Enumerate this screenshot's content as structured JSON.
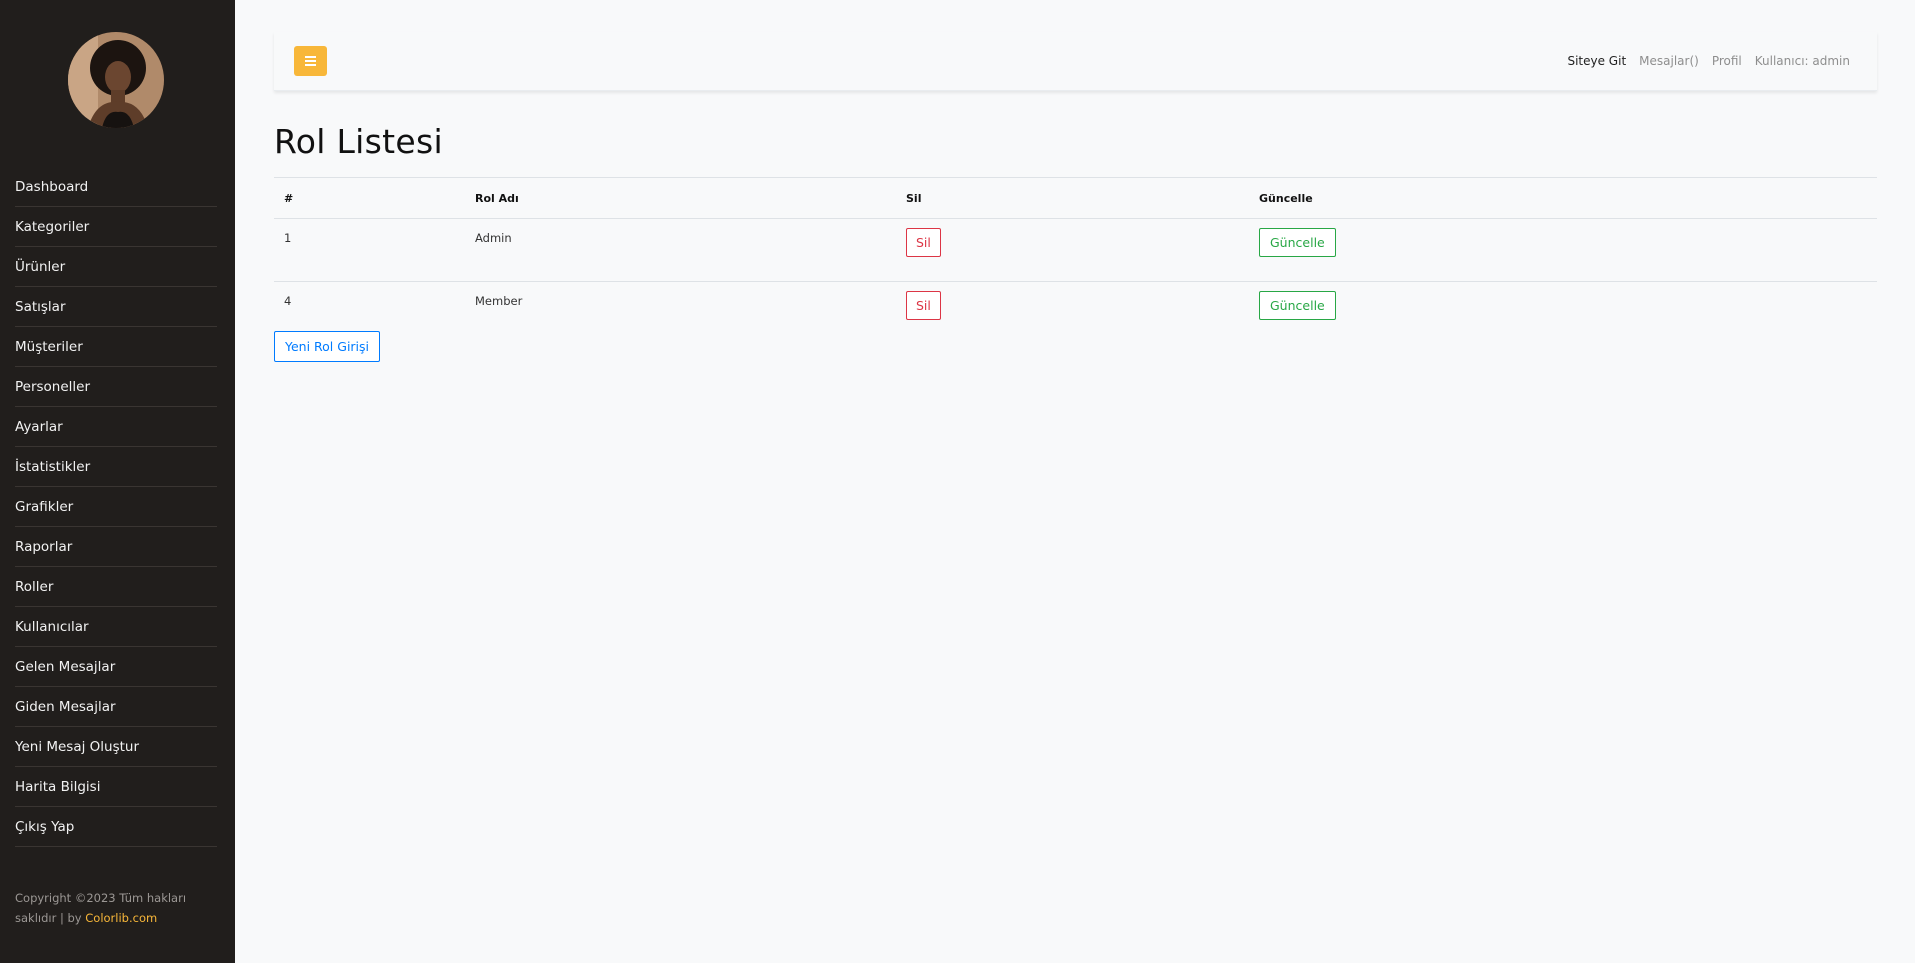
{
  "sidebar": {
    "avatar_alt": "profile-avatar",
    "items": [
      {
        "label": "Dashboard"
      },
      {
        "label": "Kategoriler"
      },
      {
        "label": "Ürünler"
      },
      {
        "label": "Satışlar"
      },
      {
        "label": "Müşteriler"
      },
      {
        "label": "Personeller"
      },
      {
        "label": "Ayarlar"
      },
      {
        "label": "İstatistikler"
      },
      {
        "label": "Grafikler"
      },
      {
        "label": "Raporlar"
      },
      {
        "label": "Roller"
      },
      {
        "label": "Kullanıcılar"
      },
      {
        "label": "Gelen Mesajlar"
      },
      {
        "label": "Giden Mesajlar"
      },
      {
        "label": "Yeni Mesaj Oluştur"
      },
      {
        "label": "Harita Bilgisi"
      },
      {
        "label": "Çıkış Yap"
      }
    ],
    "copyright_prefix": "Copyright ©2023 Tüm hakları saklıdır | by ",
    "copyright_brand": "Colorlib.com"
  },
  "topbar": {
    "toggle_icon": "hamburger-icon",
    "links": {
      "site": "Siteye Git",
      "messages": "Mesajlar()",
      "profile": "Profil",
      "user": "Kullanıcı: admin"
    }
  },
  "main": {
    "title": "Rol Listesi",
    "table": {
      "headers": {
        "id": "#",
        "name": "Rol Adı",
        "delete": "Sil",
        "update": "Güncelle"
      },
      "rows": [
        {
          "id": "1",
          "name": "Admin",
          "delete_label": "Sil",
          "update_label": "Güncelle"
        },
        {
          "id": "4",
          "name": "Member",
          "delete_label": "Sil",
          "update_label": "Güncelle"
        }
      ]
    },
    "new_button": "Yeni Rol Girişi"
  },
  "colors": {
    "sidebar_bg": "#211e1c",
    "accent": "#f8b739",
    "danger": "#dc3545",
    "success": "#28a745",
    "primary": "#007bff"
  }
}
